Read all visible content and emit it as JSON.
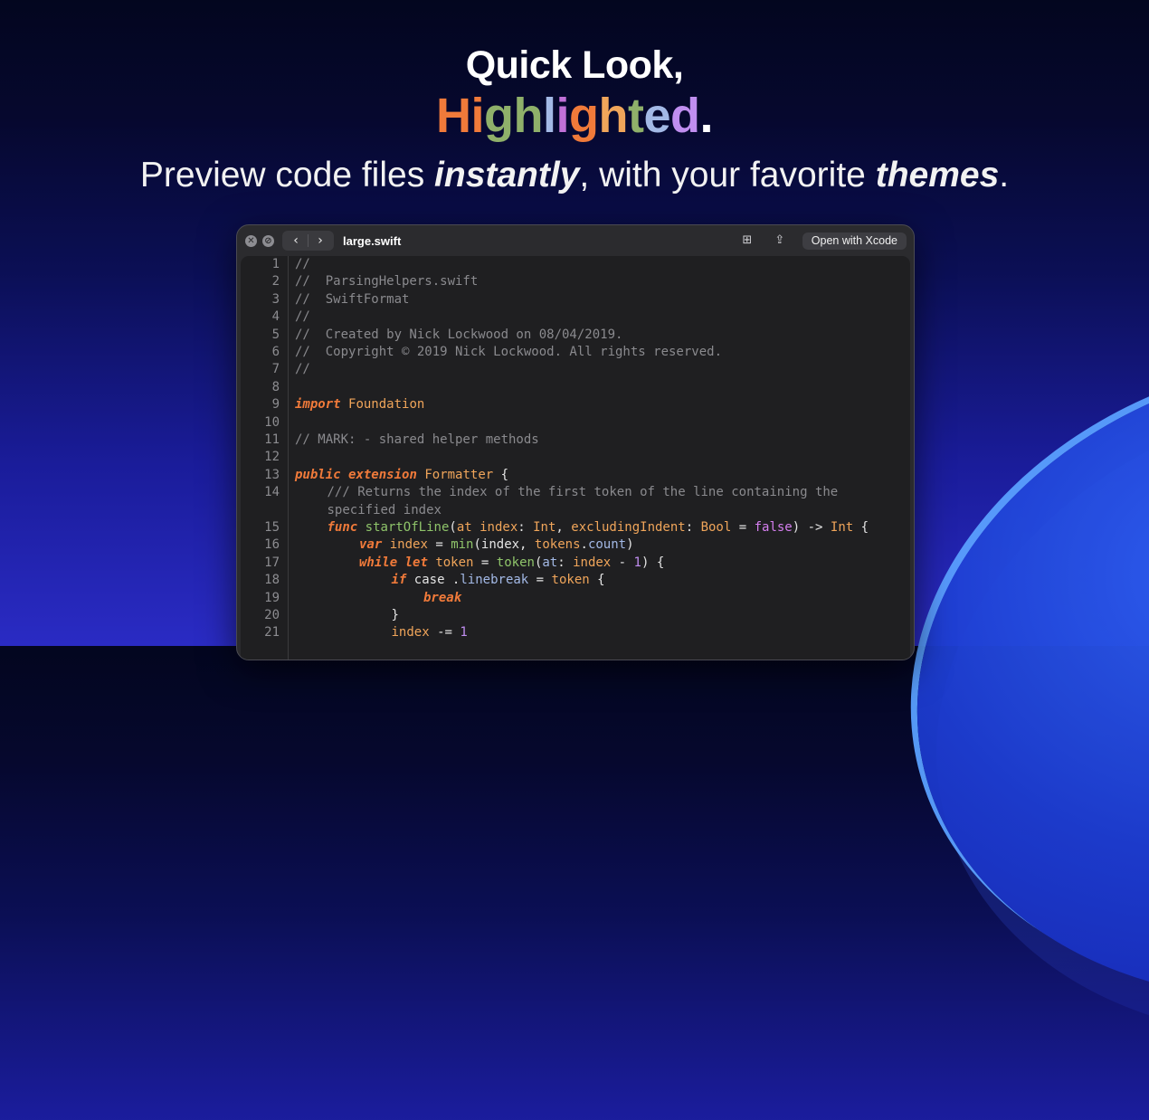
{
  "hero": {
    "line1": "Quick Look,",
    "line2_letters": [
      {
        "ch": "H",
        "color": "#f07a3a"
      },
      {
        "ch": "i",
        "color": "#f07a3a"
      },
      {
        "ch": "g",
        "color": "#8fb06a"
      },
      {
        "ch": "h",
        "color": "#8fb06a"
      },
      {
        "ch": "l",
        "color": "#a3b9e6"
      },
      {
        "ch": "i",
        "color": "#c070d8"
      },
      {
        "ch": "g",
        "color": "#f07a3a"
      },
      {
        "ch": "h",
        "color": "#f0a55a"
      },
      {
        "ch": "t",
        "color": "#8fb06a"
      },
      {
        "ch": "e",
        "color": "#a3b9e6"
      },
      {
        "ch": "d",
        "color": "#c08ef0"
      },
      {
        "ch": ".",
        "color": "#ffffff"
      }
    ],
    "tagline_parts": [
      {
        "text": "Preview code files ",
        "em": false
      },
      {
        "text": "instantly",
        "em": true
      },
      {
        "text": ", with your favorite ",
        "em": false
      },
      {
        "text": "themes",
        "em": true
      },
      {
        "text": ".",
        "em": false
      }
    ]
  },
  "window": {
    "filename": "large.swift",
    "close_icon": "✕",
    "minimize_icon": "⊘",
    "back_icon": "‹",
    "forward_icon": "›",
    "grid_icon": "⊞",
    "share_icon": "⇪",
    "open_button": "Open with Xcode"
  },
  "code_lines": [
    {
      "n": "1",
      "indent": 0,
      "tokens": [
        [
          "c",
          "//"
        ]
      ]
    },
    {
      "n": "2",
      "indent": 0,
      "tokens": [
        [
          "c",
          "//  ParsingHelpers.swift"
        ]
      ]
    },
    {
      "n": "3",
      "indent": 0,
      "tokens": [
        [
          "c",
          "//  SwiftFormat"
        ]
      ]
    },
    {
      "n": "4",
      "indent": 0,
      "tokens": [
        [
          "c",
          "//"
        ]
      ]
    },
    {
      "n": "5",
      "indent": 0,
      "tokens": [
        [
          "c",
          "//  Created by Nick Lockwood on 08/04/2019."
        ]
      ]
    },
    {
      "n": "6",
      "indent": 0,
      "tokens": [
        [
          "c",
          "//  Copyright © 2019 Nick Lockwood. All rights reserved."
        ]
      ]
    },
    {
      "n": "7",
      "indent": 0,
      "tokens": [
        [
          "c",
          "//"
        ]
      ]
    },
    {
      "n": "8",
      "indent": 0,
      "tokens": []
    },
    {
      "n": "9",
      "indent": 0,
      "tokens": [
        [
          "kw",
          "import"
        ],
        [
          "pl",
          " "
        ],
        [
          "ty",
          "Foundation"
        ]
      ]
    },
    {
      "n": "10",
      "indent": 0,
      "tokens": []
    },
    {
      "n": "11",
      "indent": 0,
      "tokens": [
        [
          "c",
          "// MARK: - shared helper methods"
        ]
      ]
    },
    {
      "n": "12",
      "indent": 0,
      "tokens": []
    },
    {
      "n": "13",
      "indent": 0,
      "tokens": [
        [
          "kw",
          "public"
        ],
        [
          "pl",
          " "
        ],
        [
          "kw",
          "extension"
        ],
        [
          "pl",
          " "
        ],
        [
          "ty",
          "Formatter"
        ],
        [
          "pl",
          " {"
        ]
      ]
    },
    {
      "n": "14",
      "indent": 1,
      "tokens": [
        [
          "c",
          "/// Returns the index of the first token of the line containing the"
        ]
      ]
    },
    {
      "n": "",
      "indent": 1,
      "tokens": [
        [
          "c",
          "specified index"
        ]
      ]
    },
    {
      "n": "15",
      "indent": 1,
      "tokens": [
        [
          "kw",
          "func"
        ],
        [
          "pl",
          " "
        ],
        [
          "fn",
          "startOfLine"
        ],
        [
          "pl",
          "("
        ],
        [
          "ty",
          "at"
        ],
        [
          "pl",
          " "
        ],
        [
          "ty",
          "index"
        ],
        [
          "pl",
          ": "
        ],
        [
          "ty",
          "Int"
        ],
        [
          "pl",
          ", "
        ],
        [
          "ty",
          "excludingIndent"
        ],
        [
          "pl",
          ": "
        ],
        [
          "ty",
          "Bool"
        ],
        [
          "pl",
          " = "
        ],
        [
          "bool",
          "false"
        ],
        [
          "pl",
          ") -> "
        ],
        [
          "ty",
          "Int"
        ],
        [
          "pl",
          " {"
        ]
      ]
    },
    {
      "n": "16",
      "indent": 2,
      "tokens": [
        [
          "kw",
          "var"
        ],
        [
          "pl",
          " "
        ],
        [
          "ty",
          "index"
        ],
        [
          "pl",
          " = "
        ],
        [
          "fn",
          "min"
        ],
        [
          "pl",
          "(index, "
        ],
        [
          "ty",
          "tokens"
        ],
        [
          "pl",
          "."
        ],
        [
          "pr",
          "count"
        ],
        [
          "pl",
          ")"
        ]
      ]
    },
    {
      "n": "17",
      "indent": 2,
      "tokens": [
        [
          "kw",
          "while"
        ],
        [
          "pl",
          " "
        ],
        [
          "kw",
          "let"
        ],
        [
          "pl",
          " "
        ],
        [
          "ty",
          "token"
        ],
        [
          "pl",
          " = "
        ],
        [
          "fn",
          "token"
        ],
        [
          "pl",
          "("
        ],
        [
          "pr",
          "at"
        ],
        [
          "pl",
          ": "
        ],
        [
          "ty",
          "index"
        ],
        [
          "pl",
          " - "
        ],
        [
          "num",
          "1"
        ],
        [
          "pl",
          ") {"
        ]
      ]
    },
    {
      "n": "18",
      "indent": 3,
      "tokens": [
        [
          "kw",
          "if"
        ],
        [
          "pl",
          " case ."
        ],
        [
          "pr",
          "linebreak"
        ],
        [
          "pl",
          " = "
        ],
        [
          "ty",
          "token"
        ],
        [
          "pl",
          " {"
        ]
      ]
    },
    {
      "n": "19",
      "indent": 4,
      "tokens": [
        [
          "kw",
          "break"
        ]
      ]
    },
    {
      "n": "20",
      "indent": 3,
      "tokens": [
        [
          "pl",
          "}"
        ]
      ]
    },
    {
      "n": "21",
      "indent": 3,
      "tokens": [
        [
          "ty",
          "index"
        ],
        [
          "pl",
          " -= "
        ],
        [
          "num",
          "1"
        ]
      ]
    }
  ]
}
